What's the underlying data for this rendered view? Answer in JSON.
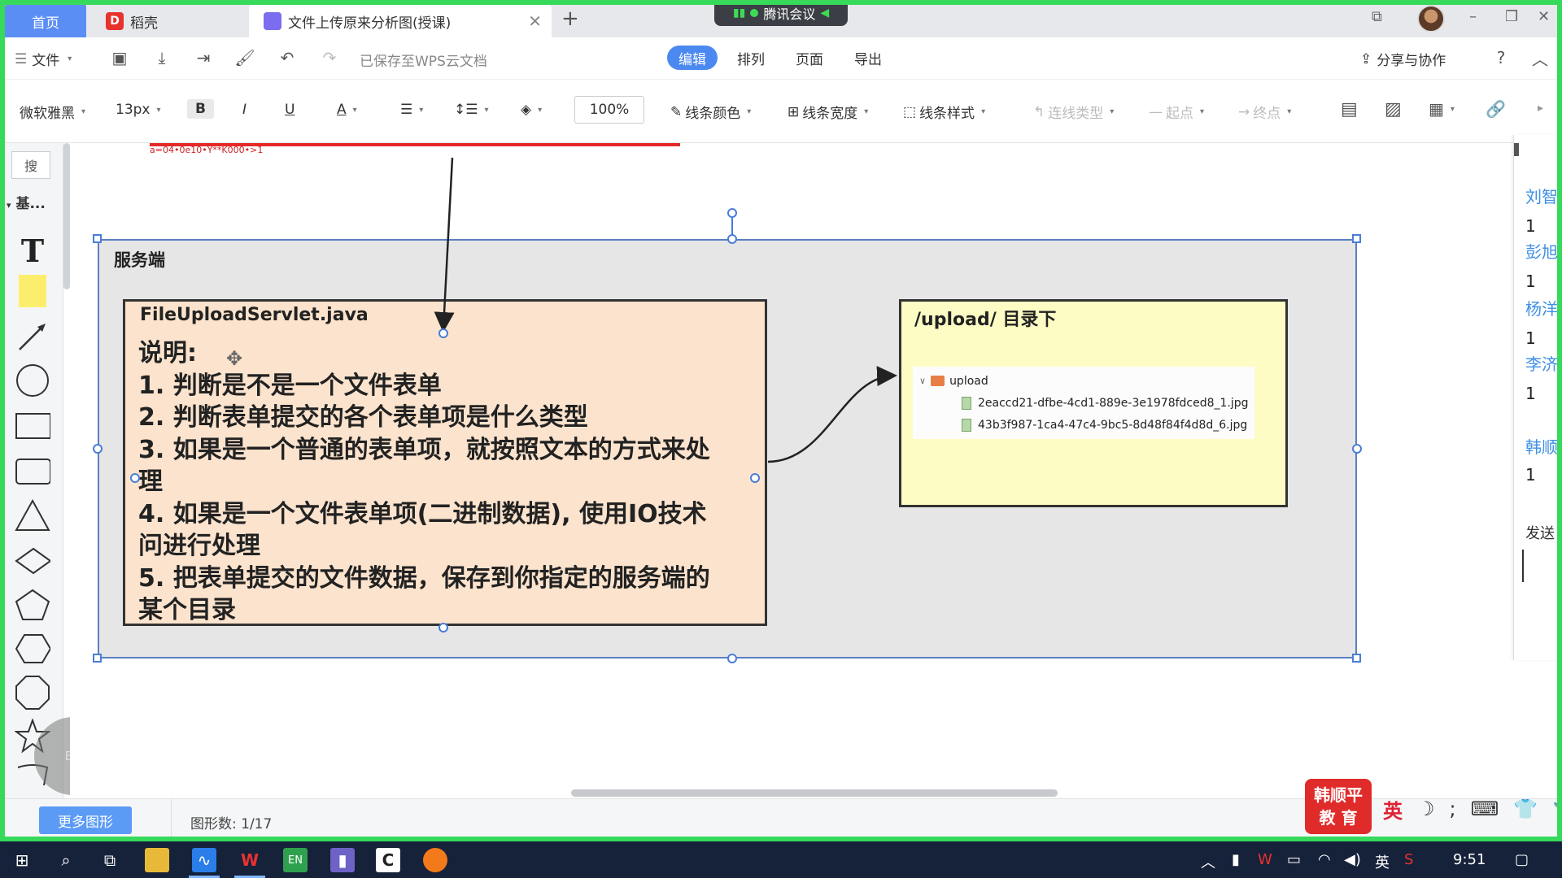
{
  "tabs": {
    "home": "首页",
    "daoke": "稻壳",
    "doc": "文件上传原来分析图(授课)",
    "doc_close": "✕",
    "new_tab": "+"
  },
  "meeting": {
    "label": "腾讯会议",
    "signal": "▮▮"
  },
  "window": {
    "minimize": "–",
    "restore": "❐",
    "close": "✕",
    "layout": "⧉"
  },
  "menubar": {
    "file": "文件",
    "saved": "已保存至WPS云文档",
    "modes": [
      "编辑",
      "排列",
      "页面",
      "导出"
    ],
    "share": "分享与协作",
    "help": "?",
    "collapse": "︿"
  },
  "format": {
    "font": "微软雅黑",
    "size": "13px",
    "bold": "B",
    "italic": "I",
    "underline": "U",
    "fontcolor": "A",
    "zoom": "100%",
    "line_color": "线条颜色",
    "line_width": "线条宽度",
    "line_style": "线条样式",
    "connector": "连线类型",
    "start": "起点",
    "end": "终点"
  },
  "leftpanel": {
    "search": "搜",
    "group": "基...",
    "text_tool": "T",
    "float_label": "EN"
  },
  "canvas": {
    "top_strip_text": "a=04•0e10•Y**K000•>1",
    "server_label": "服务端",
    "servlet_title": "FileUploadServlet.java",
    "servlet_lines": [
      "说明:",
      "1. 判断是不是一个文件表单",
      "2. 判断表单提交的各个表单项是什么类型",
      "3. 如果是一个普通的表单项，就按照文本的方式来处",
      "理",
      "4. 如果是一个文件表单项(二进制数据), 使用IO技术",
      "问进行处理",
      "5. 把表单提交的文件数据，保存到你指定的服务端的",
      "某个目录"
    ],
    "upload_title": "/upload/ 目录下",
    "tree": {
      "folder": "upload",
      "files": [
        "2eaccd21-dfbe-4cd1-889e-3e1978fdced8_1.jpg",
        "43b3f987-1ca4-47c4-9bc5-8d48f84f4d8d_6.jpg"
      ]
    }
  },
  "chat": {
    "items": [
      {
        "name": "刘智",
        "count": "1"
      },
      {
        "name": "彭旭",
        "count": "1"
      },
      {
        "name": "杨洋",
        "count": "1"
      },
      {
        "name": "李济",
        "count": "1"
      },
      {
        "name": "韩顺",
        "count": "1"
      }
    ],
    "send": "发送"
  },
  "status": {
    "more_shapes": "更多图形",
    "shape_count": "图形数: 1/17"
  },
  "brand": {
    "line1": "韩顺平",
    "line2": "教 育"
  },
  "ime": {
    "lang": "英",
    "moon": "☽",
    "semicolon": ";"
  },
  "taskbar": {
    "ime_lang": "英",
    "time": "9:51"
  },
  "colors": {
    "accent": "#4b89f0",
    "share_frame": "#37d95b",
    "servlet_fill": "#fbe3cd",
    "upload_fill": "#fdfcc4",
    "container_fill": "#e6e6e6",
    "selection": "#4a7dd6"
  }
}
